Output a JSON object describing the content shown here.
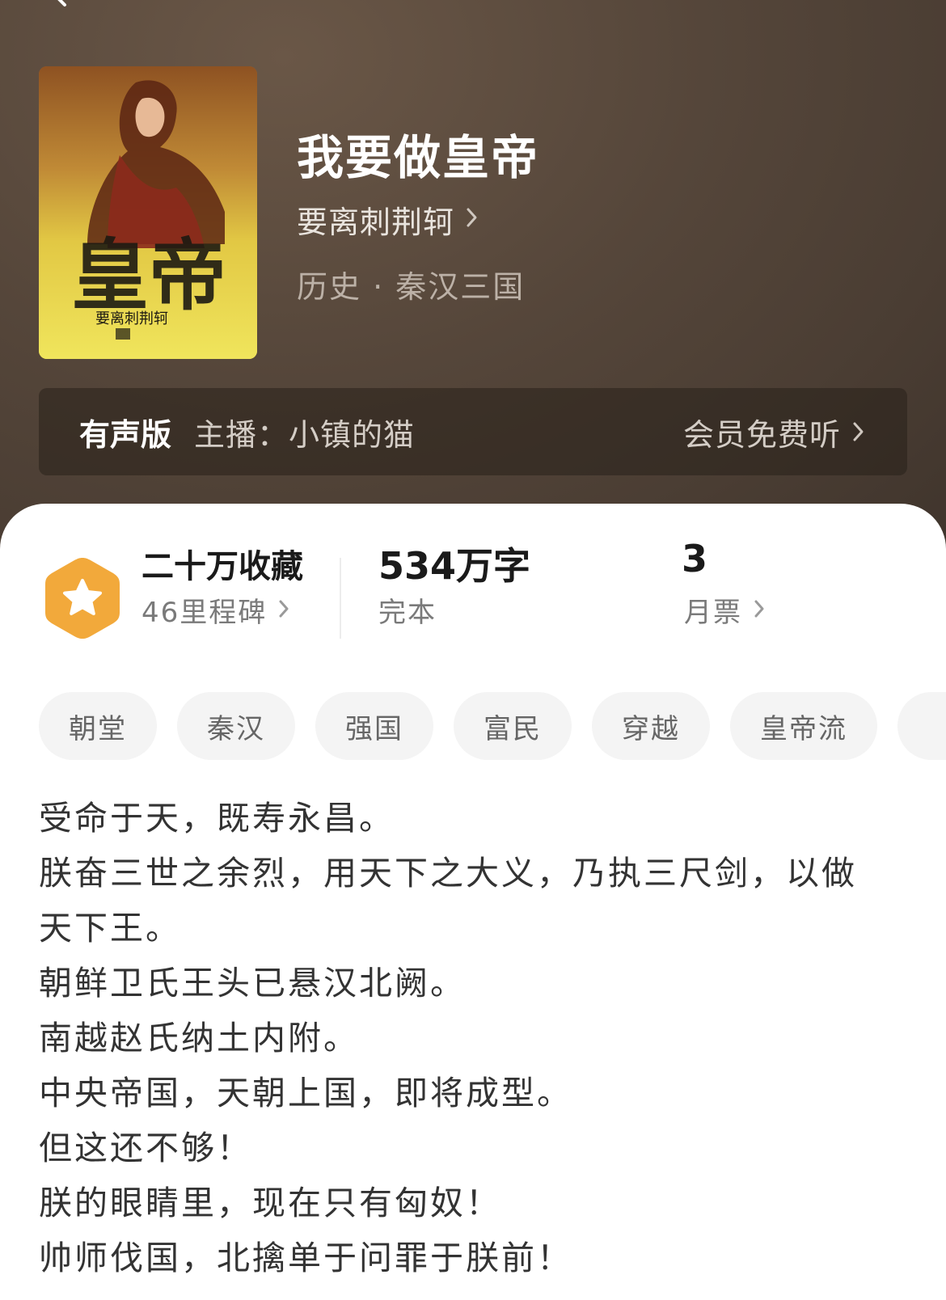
{
  "book": {
    "title": "我要做皇帝",
    "author": "要离刺荆轲",
    "genre": "历史 · 秦汉三国"
  },
  "audio": {
    "label": "有声版",
    "host": "主播：小镇的猫",
    "cta": "会员免费听"
  },
  "stats": {
    "favorites": "二十万收藏",
    "milestones": "46里程碑",
    "words": "534万字",
    "status": "完本",
    "monthly_votes": "3",
    "monthly_votes_label": "月票"
  },
  "tags": [
    "朝堂",
    "秦汉",
    "强国",
    "富民",
    "穿越",
    "皇帝流"
  ],
  "synopsis": [
    "受命于天，既寿永昌。",
    "朕奋三世之余烈，用天下之大义，乃执三尺剑，以做",
    "天下王。",
    "朝鲜卫氏王头已悬汉北阙。",
    "南越赵氏纳土内附。",
    "中央帝国，天朝上国，即将成型。",
    "但这还不够！",
    "朕的眼睛里，现在只有匈奴！",
    "帅师伐国，北擒单于问罪于朕前！"
  ],
  "colors": {
    "header_bg": "#55463a",
    "badge": "#f2a93b",
    "title_text": "#ffffff",
    "body_text": "#333333",
    "tag_bg": "#f4f4f4"
  },
  "icons": {
    "back": "chevron-left-icon",
    "forward": "chevron-right-icon",
    "badge": "star-hexagon-icon"
  }
}
